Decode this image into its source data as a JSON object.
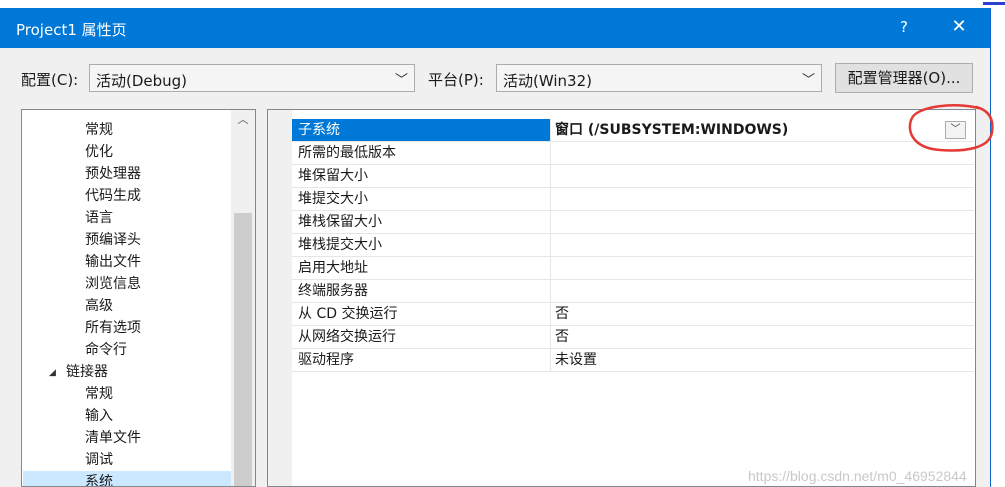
{
  "window": {
    "title": "Project1 属性页",
    "help_glyph": "?",
    "close_glyph": "✕"
  },
  "config": {
    "label": "配置(C):",
    "value": "活动(Debug)"
  },
  "platform": {
    "label": "平台(P):",
    "value": "活动(Win32)"
  },
  "config_manager_button": "配置管理器(O)...",
  "tree": {
    "items": [
      {
        "label": "常规",
        "indent": 2
      },
      {
        "label": "优化",
        "indent": 2
      },
      {
        "label": "预处理器",
        "indent": 2
      },
      {
        "label": "代码生成",
        "indent": 2
      },
      {
        "label": "语言",
        "indent": 2
      },
      {
        "label": "预编译头",
        "indent": 2
      },
      {
        "label": "输出文件",
        "indent": 2
      },
      {
        "label": "浏览信息",
        "indent": 2
      },
      {
        "label": "高级",
        "indent": 2
      },
      {
        "label": "所有选项",
        "indent": 2
      },
      {
        "label": "命令行",
        "indent": 2
      },
      {
        "label": "链接器",
        "indent": 1,
        "expanded": true
      },
      {
        "label": "常规",
        "indent": 2
      },
      {
        "label": "输入",
        "indent": 2
      },
      {
        "label": "清单文件",
        "indent": 2
      },
      {
        "label": "调试",
        "indent": 2
      },
      {
        "label": "系统",
        "indent": 2,
        "selected": true
      }
    ]
  },
  "grid": {
    "rows": [
      {
        "name": "子系统",
        "value": "窗口 (/SUBSYSTEM:WINDOWS)",
        "selected": true
      },
      {
        "name": "所需的最低版本",
        "value": ""
      },
      {
        "name": "堆保留大小",
        "value": ""
      },
      {
        "name": "堆提交大小",
        "value": ""
      },
      {
        "name": "堆栈保留大小",
        "value": ""
      },
      {
        "name": "堆栈提交大小",
        "value": ""
      },
      {
        "name": "启用大地址",
        "value": ""
      },
      {
        "name": "终端服务器",
        "value": ""
      },
      {
        "name": "从 CD 交换运行",
        "value": "否"
      },
      {
        "name": "从网络交换运行",
        "value": "否"
      },
      {
        "name": "驱动程序",
        "value": "未设置"
      }
    ]
  },
  "watermark": "https://blog.csdn.net/m0_46952844",
  "colors": {
    "titlebar": "#0078d7",
    "selection": "#0078d7",
    "tree_selection": "#cce8ff",
    "annotation": "#e53935"
  },
  "icons": {
    "dropdown": "chevron-down-icon",
    "scroll_up": "chevron-up-icon",
    "expander": "expanded-triangle-icon"
  }
}
